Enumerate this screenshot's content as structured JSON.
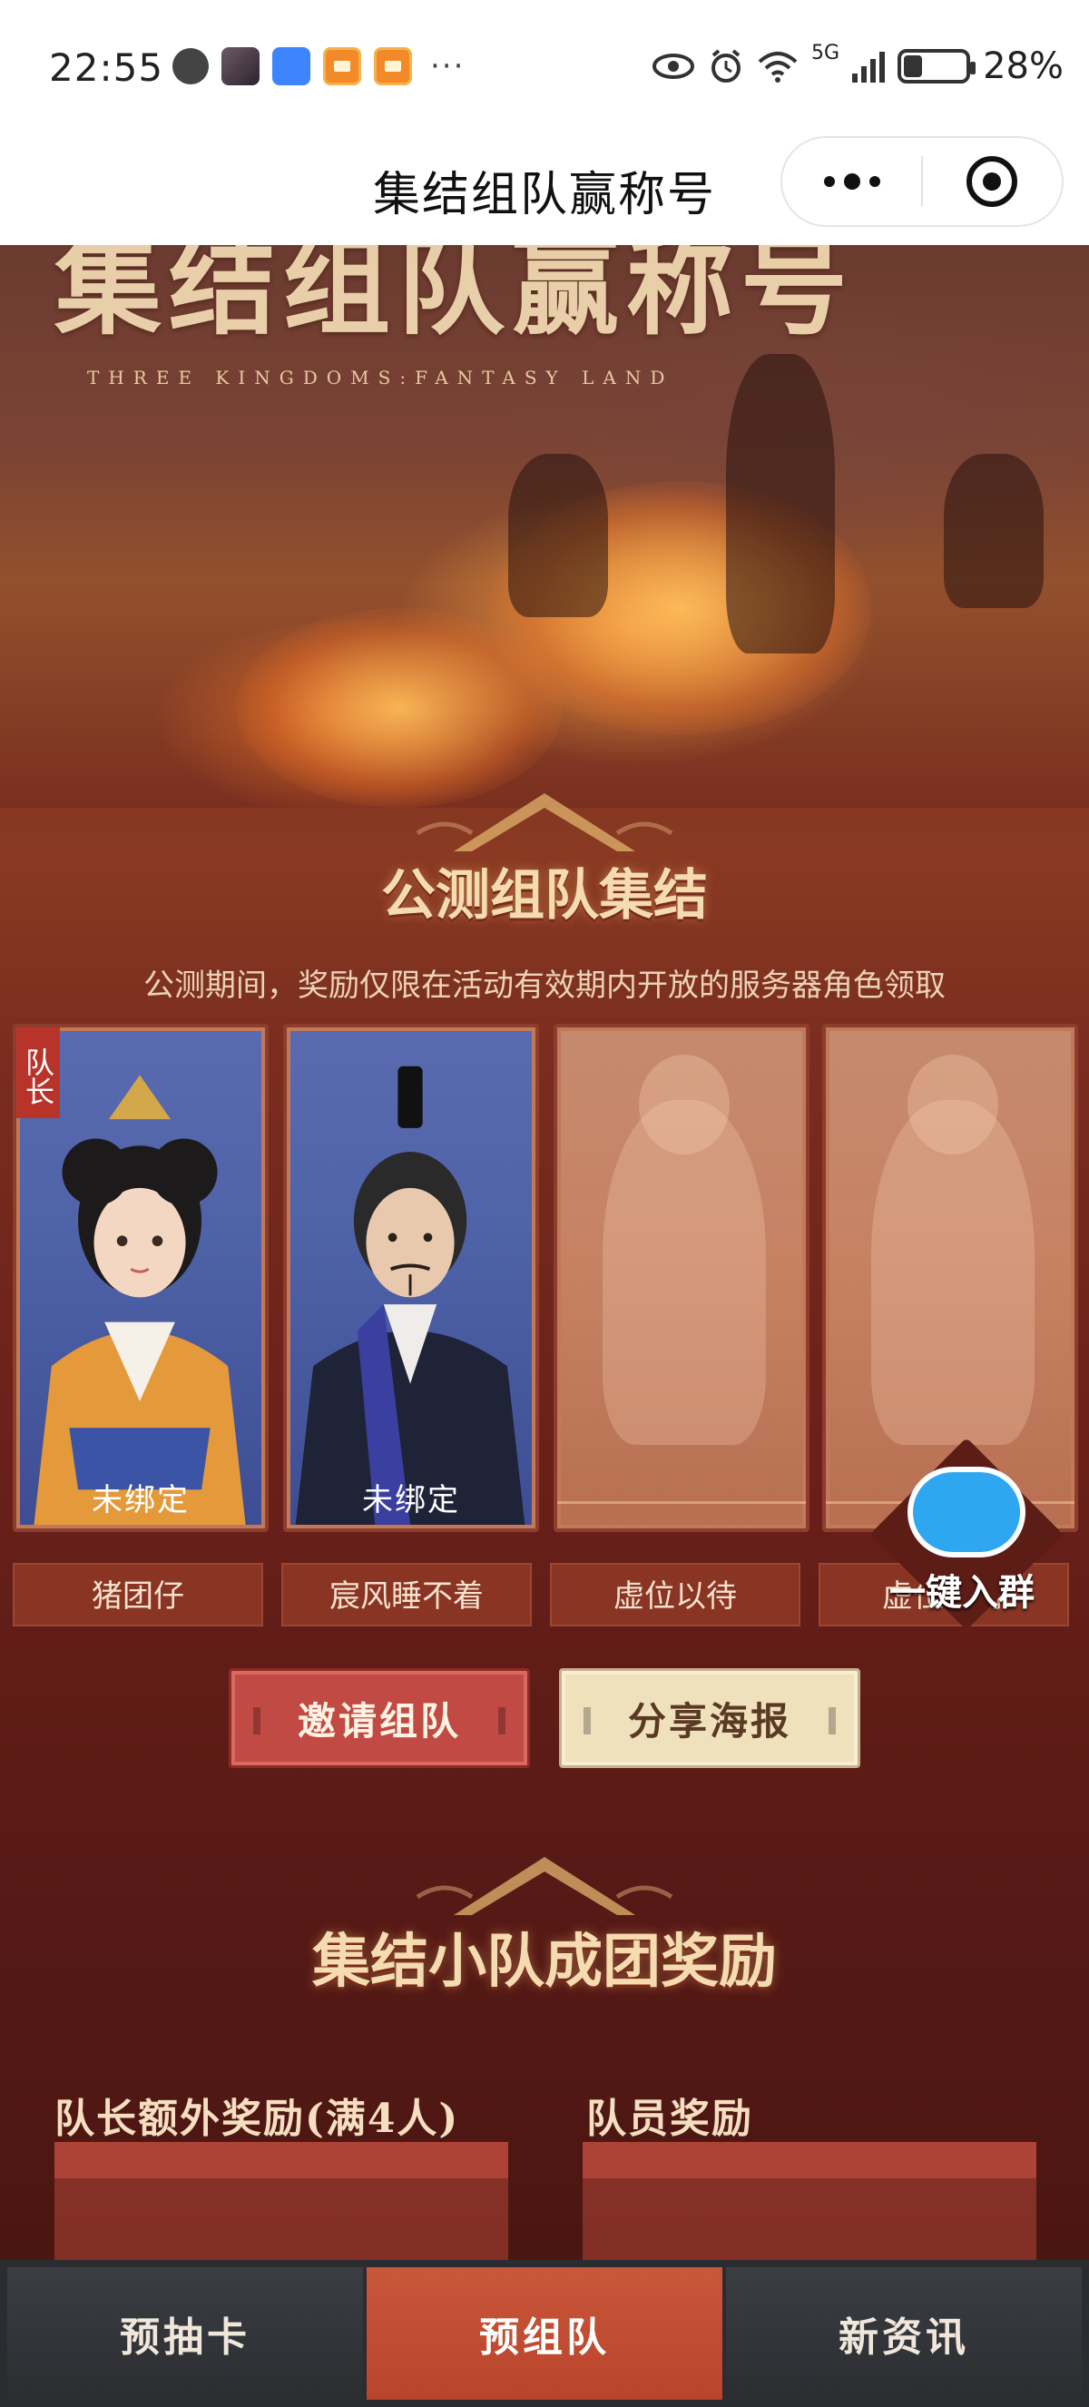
{
  "status_bar": {
    "time": "22:55",
    "network": "5G",
    "battery": "28%",
    "battery_level": 0.28,
    "more": "···",
    "icons": [
      "chat-bubble-icon",
      "game-app-icon",
      "honor-app-icon",
      "red-packet-icon",
      "red-packet-icon",
      "eye-icon",
      "alarm-icon",
      "wifi-icon",
      "signal-icon",
      "battery-icon"
    ]
  },
  "title_bar": {
    "title": "集结组队赢称号",
    "menu_icon": "more-dots-icon",
    "close_icon": "target-close-icon"
  },
  "hero": {
    "big_title": "集结组队赢称号",
    "subtitle": "THREE KINGDOMS:FANTASY LAND"
  },
  "team_section": {
    "title": "公测组队集结",
    "description": "公测期间，奖励仅限在活动有效期内开放的服务器角色领取",
    "leader_badge": "队长",
    "members": [
      {
        "name": "猪团仔",
        "status": "未绑定",
        "filled": true
      },
      {
        "name": "宸风睡不着",
        "status": "未绑定",
        "filled": true
      },
      {
        "name": "虚位以待",
        "status": "",
        "filled": false
      },
      {
        "name": "虚位以待",
        "status": "",
        "filled": false
      }
    ],
    "invite_button": "邀请组队",
    "share_button": "分享海报",
    "join_group": "一键入群"
  },
  "reward_section": {
    "title": "集结小队成团奖励",
    "leader_reward": "队长额外奖励(满4人)",
    "member_reward": "队员奖励"
  },
  "bottom_nav": {
    "tabs": [
      {
        "label": "预抽卡",
        "active": false
      },
      {
        "label": "预组队",
        "active": true
      },
      {
        "label": "新资讯",
        "active": false
      }
    ]
  },
  "colors": {
    "accent": "#c24a45",
    "active_tab": "#c9573a",
    "nav_bg": "#2a2c30",
    "card_filled": "#4f63a8",
    "card_empty": "#c78264"
  }
}
